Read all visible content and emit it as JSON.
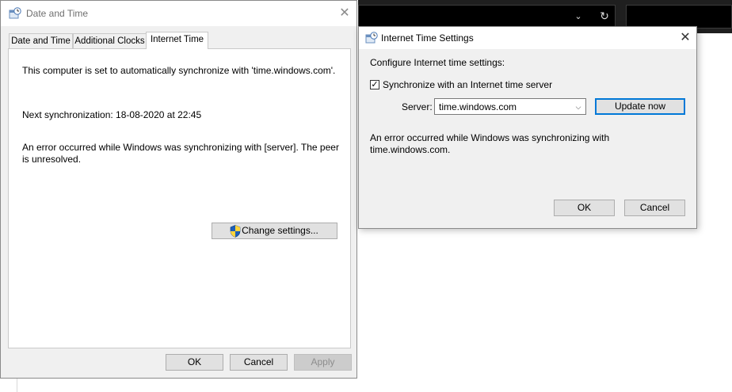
{
  "date_time_window": {
    "title": "Date and Time",
    "tabs": [
      {
        "label": "Date and Time",
        "active": false
      },
      {
        "label": "Additional Clocks",
        "active": false
      },
      {
        "label": "Internet Time",
        "active": true
      }
    ],
    "sync_status_text": "This computer is set to automatically synchronize with 'time.windows.com'.",
    "next_sync_text": "Next synchronization: 18-08-2020 at 22:45",
    "error_line1": "An error occurred while Windows was synchronizing with [server].  The peer",
    "error_line2": "is unresolved.",
    "change_settings_label": "Change settings...",
    "ok_label": "OK",
    "cancel_label": "Cancel",
    "apply_label": "Apply"
  },
  "internet_time_dialog": {
    "title": "Internet Time Settings",
    "configure_label": "Configure Internet time settings:",
    "sync_checkbox_label": "Synchronize with an Internet time server",
    "sync_checked": true,
    "server_label": "Server:",
    "server_value": "time.windows.com",
    "update_now_label": "Update now",
    "error_line1": "An error occurred while Windows was synchronizing with",
    "error_line2": "time.windows.com.",
    "ok_label": "OK",
    "cancel_label": "Cancel"
  },
  "colors": {
    "accent": "#0078d7",
    "dialog_bg": "#f0f0f0",
    "button_bg": "#e1e1e1",
    "dark_bar": "#1f1f1f"
  },
  "icons": {
    "window_icon": "date-time-clock-icon",
    "shield": "uac-shield-icon"
  }
}
